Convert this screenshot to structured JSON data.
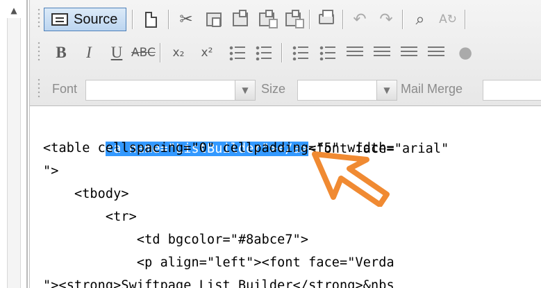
{
  "toolbar": {
    "source_label": "Source",
    "font_label": "Font",
    "size_label": "Size",
    "mail_merge_label": "Mail Merge",
    "row1_icons": [
      "source-icon",
      "new-page-icon",
      "cut-icon",
      "copy-icon",
      "paste-icon",
      "paste-word-icon",
      "paste-text-icon",
      "print-icon",
      "undo-icon",
      "redo-icon",
      "find-icon",
      "replace-icon"
    ],
    "row2_labels": {
      "bold": "B",
      "italic": "I",
      "underline": "U",
      "strike": "ABC",
      "subscript": "x₂",
      "superscript": "x²"
    }
  },
  "code": {
    "line1_selected": "<a name=\"ListBuilder\"></a>",
    "line1_rest": "<font face=\"arial\"",
    "line2": "<table cellspacing=\"0\" cellpadding=\"5\" width=",
    "line3": "\">",
    "line4": "    <tbody>",
    "line5": "        <tr>",
    "line6": "            <td bgcolor=\"#8abce7\">",
    "line7": "            <p align=\"left\"><font face=\"Verda",
    "line8": "\"><strong>Swiftpage List Builder</strong>&nbs"
  },
  "colors": {
    "selection": "#3399ff",
    "cursor": "#f08a32"
  }
}
